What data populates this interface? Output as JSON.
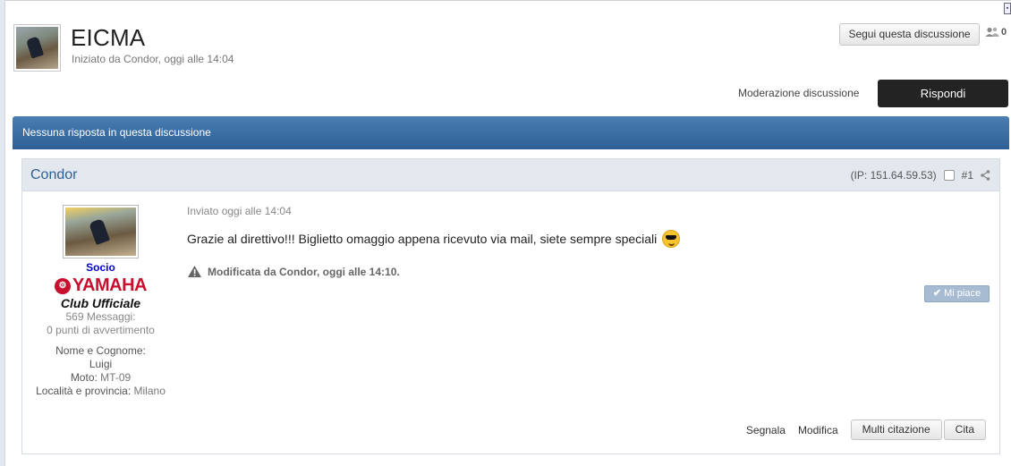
{
  "topic": {
    "title": "EICMA",
    "meta": "Iniziato da Condor, oggi alle 14:04",
    "follow_label": "Segui questa discussione",
    "followers_count": "0"
  },
  "toolbar": {
    "moderation_label": "Moderazione discussione",
    "reply_label": "Rispondi"
  },
  "banner": {
    "text": "Nessuna risposta in questa discussione"
  },
  "post": {
    "author": "Condor",
    "ip": "(IP: 151.64.59.53)",
    "number": "#1",
    "date": "Inviato oggi alle 14:04",
    "body": "Grazie al direttivo!!! Biglietto omaggio appena ricevuto via mail, siete sempre speciali",
    "edit_note": "Modificata da Condor, oggi alle 14:10.",
    "like_label": "Mi piace",
    "actions": {
      "report": "Segnala",
      "edit": "Modifica",
      "multiquote": "Multi citazione",
      "quote": "Cita"
    }
  },
  "user": {
    "rank": "Socio",
    "yamaha_emblem": "⚙",
    "yamaha_brand": "YAMAHA",
    "club": "Club Ufficiale",
    "posts": "569 Messaggi:",
    "warnings": "0 punti di avvertimento",
    "name_label": "Nome e Cognome:",
    "name_value": "Luigi",
    "bike_label": "Moto:",
    "bike_value": "MT-09",
    "location_label": "Località e provincia:",
    "location_value": "Milano"
  },
  "colors": {
    "banner": "#2d5f95",
    "reply_button": "#232323",
    "link_blue": "#2d5f95",
    "rank_blue": "#0000cc",
    "yamaha_red": "#c8102e"
  },
  "icons": {
    "followers": "users-icon",
    "share": "share-icon",
    "warning": "warning-icon",
    "like": "check-icon",
    "emoji": "sunglasses-emoji"
  }
}
